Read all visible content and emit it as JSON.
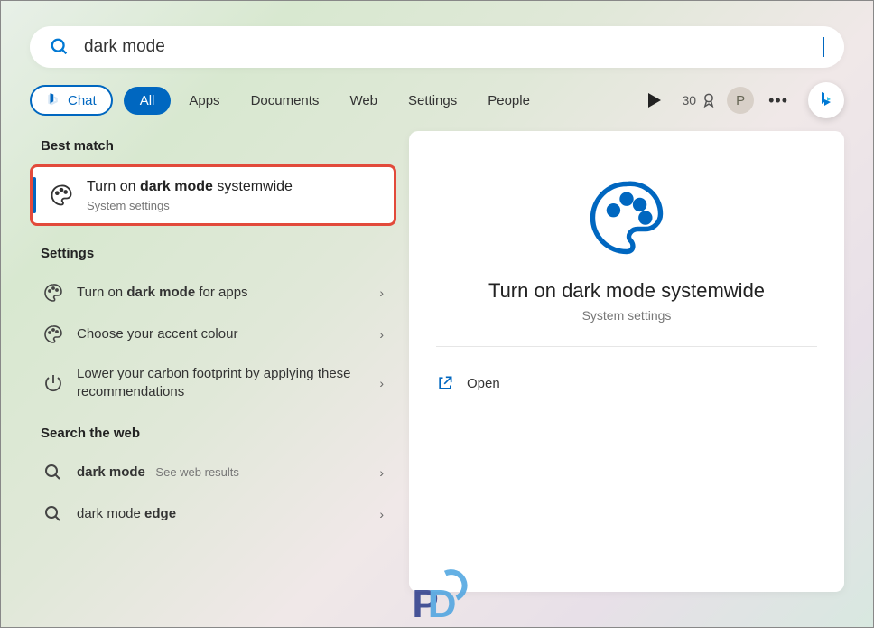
{
  "search": {
    "query": "dark mode"
  },
  "tabs": {
    "chat": "Chat",
    "all": "All",
    "apps": "Apps",
    "documents": "Documents",
    "web": "Web",
    "settings": "Settings",
    "people": "People",
    "points": "30",
    "avatar_initial": "P"
  },
  "sections": {
    "best_match": "Best match",
    "settings": "Settings",
    "search_web": "Search the web"
  },
  "best_match": {
    "title_pre": "Turn on ",
    "title_bold": "dark mode",
    "title_post": " systemwide",
    "subtitle": "System settings"
  },
  "settings_results": [
    {
      "pre": "Turn on ",
      "bold": "dark mode",
      "post": " for apps",
      "icon": "palette"
    },
    {
      "pre": "Choose your accent colour",
      "bold": "",
      "post": "",
      "icon": "palette"
    },
    {
      "pre": "Lower your carbon footprint by applying these recommendations",
      "bold": "",
      "post": "",
      "icon": "power"
    }
  ],
  "web_results": [
    {
      "pre": "",
      "bold": "dark mode",
      "post": "",
      "suffix": " - See web results"
    },
    {
      "pre": "dark mode ",
      "bold": "edge",
      "post": "",
      "suffix": ""
    }
  ],
  "detail": {
    "title": "Turn on dark mode systemwide",
    "subtitle": "System settings",
    "action_open": "Open"
  }
}
